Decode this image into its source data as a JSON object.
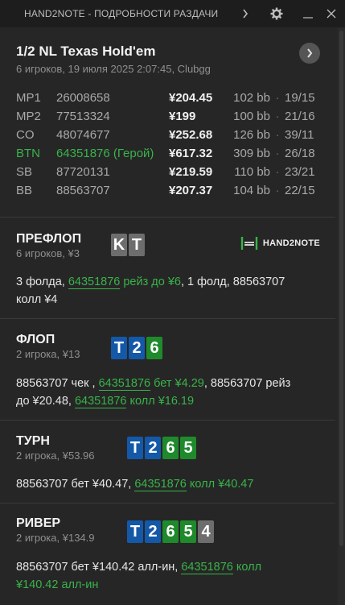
{
  "window": {
    "title": "HAND2NOTE - ПОДРОБНОСТИ РАЗДАЧИ"
  },
  "hand": {
    "game": "1/2 NL Texas Hold'em",
    "details": "6 игроков, 19 июля 2025 2:07:45, Clubgg",
    "players": [
      {
        "pos": "MP1",
        "id": "26008658",
        "stack": "¥204.45",
        "bb": "102 bb",
        "vpip": "19/15"
      },
      {
        "pos": "MP2",
        "id": "77513324",
        "stack": "¥199",
        "bb": "100 bb",
        "vpip": "21/16"
      },
      {
        "pos": "CO",
        "id": "48074677",
        "stack": "¥252.68",
        "bb": "126 bb",
        "vpip": "39/11"
      },
      {
        "pos": "BTN",
        "id": "64351876 (Герой)",
        "stack": "¥617.32",
        "bb": "309 bb",
        "vpip": "26/18"
      },
      {
        "pos": "SB",
        "id": "87720131",
        "stack": "¥219.59",
        "bb": "110 bb",
        "vpip": "23/21"
      },
      {
        "pos": "BB",
        "id": "88563707",
        "stack": "¥207.37",
        "bb": "104 bb",
        "vpip": "22/15"
      }
    ],
    "sep": "·"
  },
  "logo": {
    "text": "HAND2NOTE"
  },
  "preflop": {
    "name": "ПРЕФЛОП",
    "info": "6 игроков, ¥3",
    "cards": [
      "K",
      "T"
    ],
    "a1": "3 фолда, ",
    "a2": "64351876",
    "a3": " рейз до ¥6",
    "a4": ", 1 фолд, 88563707",
    "a5": "колл ¥4"
  },
  "flop": {
    "name": "ФЛОП",
    "info": "2 игрока, ¥13",
    "cards": [
      "T",
      "2",
      "6"
    ],
    "a1": "88563707",
    "a2": " чек , ",
    "a3": "64351876",
    "a4": " бет ¥4.29",
    "a5": ", 88563707 рейз",
    "a6": "до ¥20.48, ",
    "a7": "64351876",
    "a8": " колл ¥16.19"
  },
  "turn": {
    "name": "ТУРН",
    "info": "2 игрока, ¥53.96",
    "cards": [
      "T",
      "2",
      "6",
      "5"
    ],
    "a1": "88563707 бет ¥40.47, ",
    "a2": "64351876",
    "a3": " колл ¥40.47"
  },
  "river": {
    "name": "РИВЕР",
    "info": "2 игрока, ¥134.9",
    "cards": [
      "T",
      "2",
      "6",
      "5",
      "4"
    ],
    "a1": "88563707 бет ¥140.42 алл-ин, ",
    "a2": "64351876",
    "a3": " колл",
    "a4": "¥140.42 алл-ин"
  }
}
